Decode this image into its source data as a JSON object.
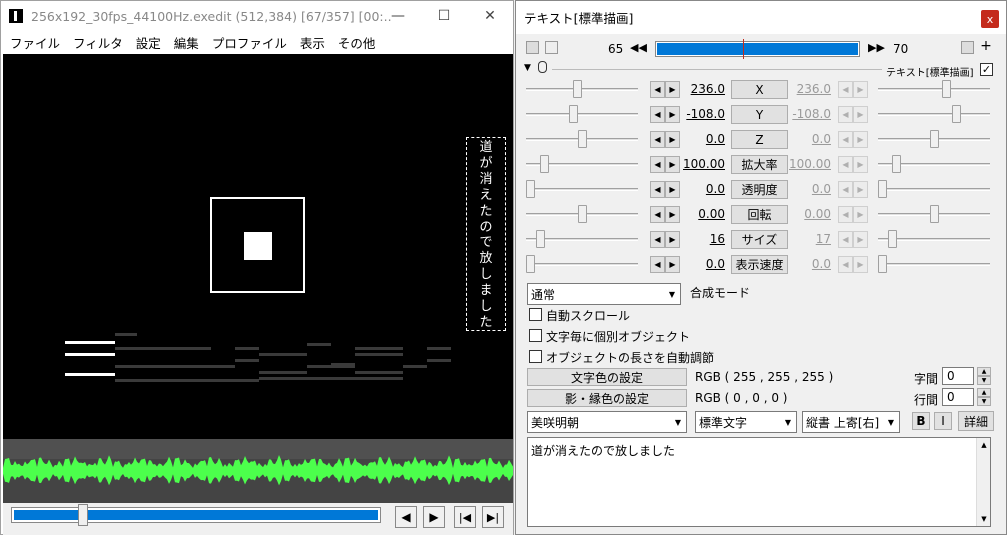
{
  "left_window": {
    "title": "256x192_30fps_44100Hz.exedit (512,384)  [67/357] [00:...",
    "menu": [
      "ファイル",
      "フィルタ",
      "設定",
      "編集",
      "プロファイル",
      "表示",
      "その他"
    ],
    "vertical_text_chars": [
      "道",
      "が",
      "消",
      "え",
      "た",
      "の",
      "で",
      "放",
      "し",
      "ま",
      "し",
      "た"
    ]
  },
  "right_window": {
    "title": "テキスト[標準描画]",
    "close_label": "x",
    "frame_start": "65",
    "frame_end": "70",
    "frame_progress": 0.43,
    "filter_name": "テキスト[標準描画]",
    "params": [
      {
        "name": "X",
        "start": "236.0",
        "end": "236.0",
        "start_pos": 0.46,
        "end_pos": 0.62
      },
      {
        "name": "Y",
        "start": "-108.0",
        "end": "-108.0",
        "start_pos": 0.42,
        "end_pos": 0.72
      },
      {
        "name": "Z",
        "start": "0.0",
        "end": "0.0",
        "start_pos": 0.5,
        "end_pos": 0.5
      },
      {
        "name": "拡大率",
        "start": "100.00",
        "end": "100.00",
        "start_pos": 0.14,
        "end_pos": 0.14
      },
      {
        "name": "透明度",
        "start": "0.0",
        "end": "0.0",
        "start_pos": 0.0,
        "end_pos": 0.0
      },
      {
        "name": "回転",
        "start": "0.00",
        "end": "0.00",
        "start_pos": 0.5,
        "end_pos": 0.5
      },
      {
        "name": "サイズ",
        "start": "16",
        "end": "17",
        "start_pos": 0.1,
        "end_pos": 0.1
      },
      {
        "name": "表示速度",
        "start": "0.0",
        "end": "0.0",
        "start_pos": 0.0,
        "end_pos": 0.0
      }
    ],
    "blend_mode_value": "通常",
    "blend_mode_label": "合成モード",
    "checkboxes": [
      "自動スクロール",
      "文字毎に個別オブジェクト",
      "オブジェクトの長さを自動調節"
    ],
    "text_color_button": "文字色の設定",
    "text_color_value": "RGB ( 255 , 255 , 255 )",
    "shadow_color_button": "影・縁色の設定",
    "shadow_color_value": "RGB ( 0 , 0 , 0 )",
    "char_spacing_label": "字間",
    "char_spacing_value": "0",
    "line_spacing_label": "行間",
    "line_spacing_value": "0",
    "font_value": "美咲明朝",
    "style_value": "標準文字",
    "align_value": "縦書 上寄[右]",
    "bold_label": "B",
    "italic_label": "I",
    "detail_label": "詳細",
    "text_content": "道が消えたので放しました"
  },
  "colors": {
    "accent": "#0078d7",
    "waveform": "#4cff4c",
    "close": "#c42b1c"
  }
}
